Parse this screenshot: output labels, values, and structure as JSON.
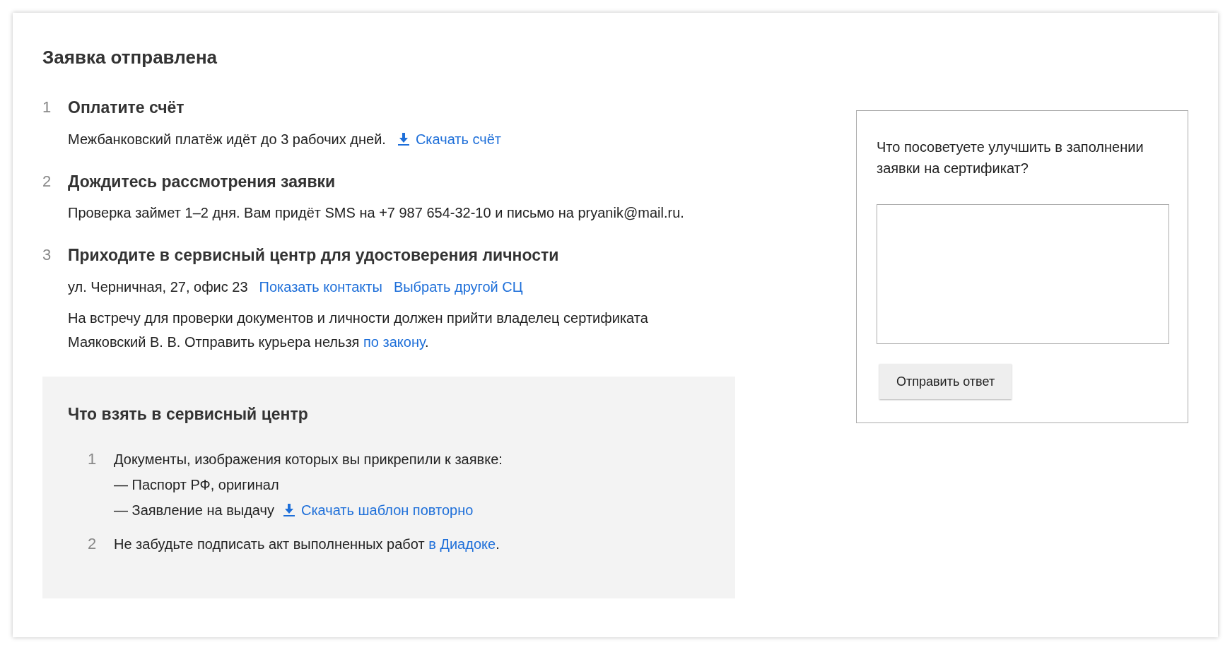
{
  "title": "Заявка отправлена",
  "steps": [
    {
      "number": "1",
      "title": "Оплатите счёт",
      "lines": [
        {
          "parts": [
            {
              "kind": "text",
              "text": "Межбанковский платёж идёт до 3 рабочих дней."
            },
            {
              "kind": "download",
              "text": "Скачать счёт"
            }
          ]
        }
      ]
    },
    {
      "number": "2",
      "title": "Дождитесь рассмотрения заявки",
      "lines": [
        {
          "parts": [
            {
              "kind": "text",
              "text": "Проверка займет 1–2 дня. Вам придёт SMS на +7 987 654-32-10 и письмо на pryanik@mail.ru."
            }
          ]
        }
      ]
    },
    {
      "number": "3",
      "title": "Приходите в сервисный центр для удостоверения личности",
      "lines": [
        {
          "parts": [
            {
              "kind": "text",
              "text": "ул. Черничная, 27, офис 23"
            },
            {
              "kind": "link",
              "text": "Показать контакты"
            },
            {
              "kind": "link",
              "text": "Выбрать другой СЦ"
            }
          ]
        }
      ],
      "note": {
        "text": "На встречу для проверки документов и личности должен прийти владелец сертификата Маяковский В. В. Отправить курьера нельзя",
        "link": "по закону",
        "end": "."
      }
    }
  ],
  "checklist": {
    "title": "Что взять в сервисный центр",
    "items": [
      {
        "number": "1",
        "text": "Документы, изображения которых вы прикрепили к заявке:",
        "subitems": [
          {
            "text": "— Паспорт РФ, оригинал"
          },
          {
            "text": "— Заявление на выдачу",
            "download": "Скачать шаблон повторно"
          }
        ]
      },
      {
        "number": "2",
        "text": "Не забудьте подписать акт выполненных работ",
        "link": "в Диадоке",
        "end": "."
      }
    ]
  },
  "feedback": {
    "question": "Что посоветуете улучшить в заполнении заявки на сертификат?",
    "button": "Отправить ответ"
  }
}
